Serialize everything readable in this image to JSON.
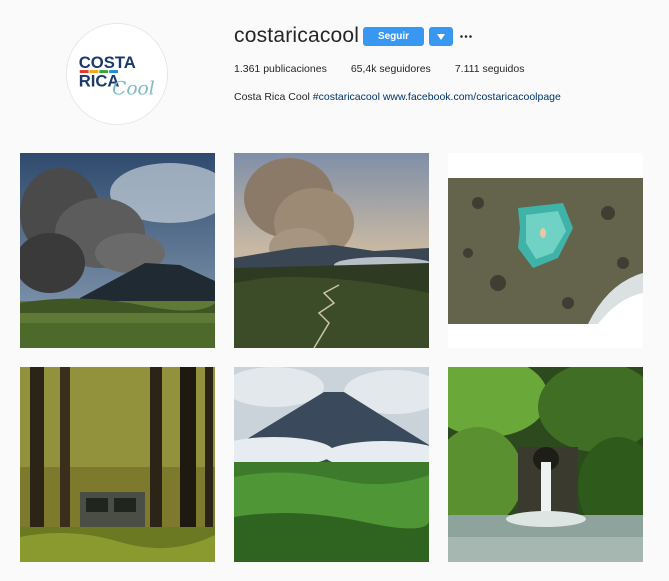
{
  "profile": {
    "username": "costaricacool",
    "follow_label": "Seguir",
    "stats": {
      "posts": "1.361 publicaciones",
      "followers": "65,4k seguidores",
      "following": "7.111 seguidos"
    },
    "bio": {
      "name": "Costa Rica Cool",
      "hashtag": "#costaricacool",
      "link": "www.facebook.com/costaricacoolpage"
    },
    "logo": {
      "word1": "COSTA",
      "word2": "RICA",
      "word3": "Cool"
    }
  },
  "icons": {
    "dropdown": "chevron-down-icon",
    "more": "more-options-icon"
  },
  "posts": [
    {
      "subject": "volcano-eruption-smoke-over-pasture"
    },
    {
      "subject": "volcano-eruption-with-winding-road"
    },
    {
      "subject": "aerial-tide-pool-swimmer"
    },
    {
      "subject": "abandoned-car-in-forest"
    },
    {
      "subject": "volcano-above-clouds-and-jungle"
    },
    {
      "subject": "jungle-waterfall-pool"
    }
  ],
  "colors": {
    "accent": "#3897f0",
    "link": "#003569",
    "background": "#fafafa"
  }
}
